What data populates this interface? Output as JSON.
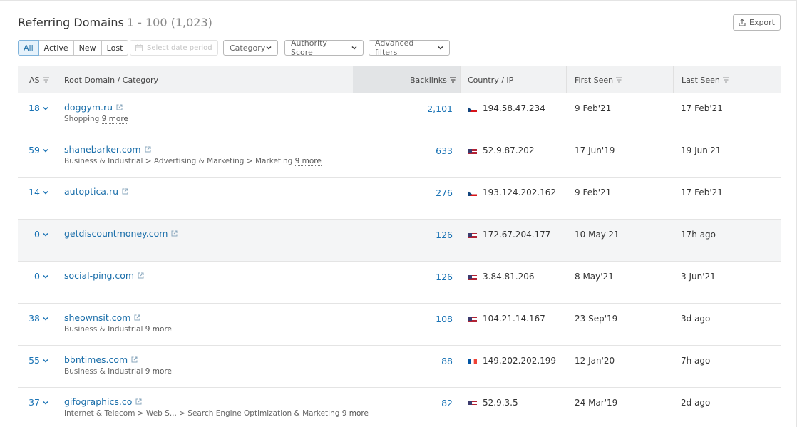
{
  "header": {
    "title": "Referring Domains",
    "range": "1 - 100 (1,023)",
    "export_label": "Export"
  },
  "filters": {
    "segments": [
      "All",
      "Active",
      "New",
      "Lost"
    ],
    "active_segment": "All",
    "date_placeholder": "Select date period",
    "category_label": "Category",
    "authority_label": "Authority Score",
    "advanced_label": "Advanced filters"
  },
  "table": {
    "columns": {
      "as": "AS",
      "root_domain": "Root Domain / Category",
      "backlinks": "Backlinks",
      "country_ip": "Country / IP",
      "first_seen": "First Seen",
      "last_seen": "Last Seen"
    },
    "rows": [
      {
        "as": "18",
        "domain": "doggym.ru",
        "category": "Shopping",
        "more": "9 more",
        "backlinks": "2,101",
        "flag": "cz",
        "ip": "194.58.47.234",
        "first_seen": "9 Feb'21",
        "last_seen": "17 Feb'21",
        "highlighted": false
      },
      {
        "as": "59",
        "domain": "shanebarker.com",
        "category": "Business & Industrial > Advertising & Marketing > Marketing",
        "more": "9 more",
        "backlinks": "633",
        "flag": "us",
        "ip": "52.9.87.202",
        "first_seen": "17 Jun'19",
        "last_seen": "19 Jun'21",
        "highlighted": false
      },
      {
        "as": "14",
        "domain": "autoptica.ru",
        "category": "",
        "more": "",
        "backlinks": "276",
        "flag": "cz",
        "ip": "193.124.202.162",
        "first_seen": "9 Feb'21",
        "last_seen": "17 Feb'21",
        "highlighted": false
      },
      {
        "as": "0",
        "domain": "getdiscountmoney.com",
        "category": "",
        "more": "",
        "backlinks": "126",
        "flag": "us",
        "ip": "172.67.204.177",
        "first_seen": "10 May'21",
        "last_seen": "17h ago",
        "highlighted": true
      },
      {
        "as": "0",
        "domain": "social-ping.com",
        "category": "",
        "more": "",
        "backlinks": "126",
        "flag": "us",
        "ip": "3.84.81.206",
        "first_seen": "8 May'21",
        "last_seen": "3 Jun'21",
        "highlighted": false
      },
      {
        "as": "38",
        "domain": "sheownsit.com",
        "category": "Business & Industrial",
        "more": "9 more",
        "backlinks": "108",
        "flag": "us",
        "ip": "104.21.14.167",
        "first_seen": "23 Sep'19",
        "last_seen": "3d ago",
        "highlighted": false
      },
      {
        "as": "55",
        "domain": "bbntimes.com",
        "category": "Business & Industrial",
        "more": "9 more",
        "backlinks": "88",
        "flag": "fr",
        "ip": "149.202.202.199",
        "first_seen": "12 Jan'20",
        "last_seen": "7h ago",
        "highlighted": false
      },
      {
        "as": "37",
        "domain": "gifographics.co",
        "category": "Internet & Telecom > Web S... > Search Engine Optimization & Marketing",
        "more": "9 more",
        "backlinks": "82",
        "flag": "us",
        "ip": "52.9.3.5",
        "first_seen": "24 Mar'19",
        "last_seen": "2d ago",
        "highlighted": false
      }
    ]
  },
  "colors": {
    "link": "#1a6eaa",
    "active_segment_bg": "#e6f2fb",
    "header_bg": "#f1f2f3",
    "highlight_row_bg": "#f4f5f6"
  }
}
